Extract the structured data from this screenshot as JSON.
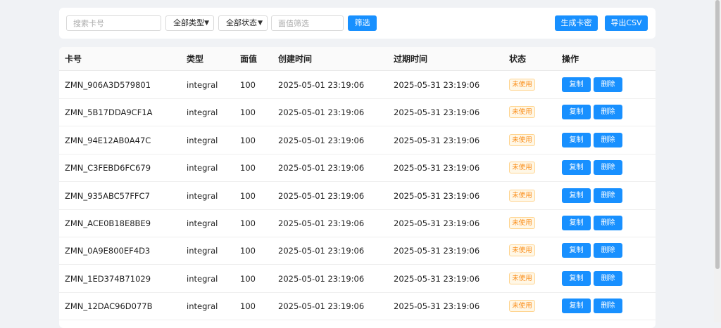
{
  "toolbar": {
    "search_placeholder": "搜索卡号",
    "type_select": "全部类型",
    "status_select": "全部状态",
    "value_placeholder": "面值筛选",
    "filter_button": "筛选",
    "generate_button": "生成卡密",
    "export_button": "导出CSV"
  },
  "table": {
    "headers": [
      "卡号",
      "类型",
      "面值",
      "创建时间",
      "过期时间",
      "状态",
      "操作"
    ],
    "copy_label": "复制",
    "delete_label": "删除",
    "rows": [
      {
        "card": "ZMN_906A3D579801",
        "type": "integral",
        "value": "100",
        "created": "2025-05-01 23:19:06",
        "expires": "2025-05-31 23:19:06",
        "status": "未使用"
      },
      {
        "card": "ZMN_5B17DDA9CF1A",
        "type": "integral",
        "value": "100",
        "created": "2025-05-01 23:19:06",
        "expires": "2025-05-31 23:19:06",
        "status": "未使用"
      },
      {
        "card": "ZMN_94E12AB0A47C",
        "type": "integral",
        "value": "100",
        "created": "2025-05-01 23:19:06",
        "expires": "2025-05-31 23:19:06",
        "status": "未使用"
      },
      {
        "card": "ZMN_C3FEBD6FC679",
        "type": "integral",
        "value": "100",
        "created": "2025-05-01 23:19:06",
        "expires": "2025-05-31 23:19:06",
        "status": "未使用"
      },
      {
        "card": "ZMN_935ABC57FFC7",
        "type": "integral",
        "value": "100",
        "created": "2025-05-01 23:19:06",
        "expires": "2025-05-31 23:19:06",
        "status": "未使用"
      },
      {
        "card": "ZMN_ACE0B18E8BE9",
        "type": "integral",
        "value": "100",
        "created": "2025-05-01 23:19:06",
        "expires": "2025-05-31 23:19:06",
        "status": "未使用"
      },
      {
        "card": "ZMN_0A9E800EF4D3",
        "type": "integral",
        "value": "100",
        "created": "2025-05-01 23:19:06",
        "expires": "2025-05-31 23:19:06",
        "status": "未使用"
      },
      {
        "card": "ZMN_1ED374B71029",
        "type": "integral",
        "value": "100",
        "created": "2025-05-01 23:19:06",
        "expires": "2025-05-31 23:19:06",
        "status": "未使用"
      },
      {
        "card": "ZMN_12DAC96D077B",
        "type": "integral",
        "value": "100",
        "created": "2025-05-01 23:19:06",
        "expires": "2025-05-31 23:19:06",
        "status": "未使用"
      }
    ]
  },
  "colors": {
    "primary": "#1890ff",
    "status_unused": "#fa8c16"
  }
}
